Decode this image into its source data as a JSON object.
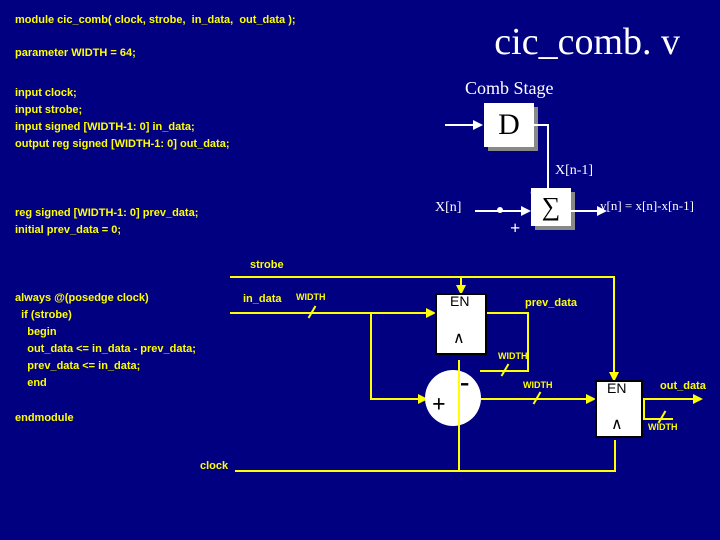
{
  "title": "cic_comb. v",
  "comb_stage": "Comb Stage",
  "code": {
    "l1": "module cic_comb( clock, strobe,  in_data,  out_data );",
    "l2": "parameter WIDTH = 64;",
    "l3": "input clock;",
    "l4": "input strobe;",
    "l5": "input signed [WIDTH-1: 0] in_data;",
    "l6": "output reg signed [WIDTH-1: 0] out_data;",
    "l7": "reg signed [WIDTH-1: 0] prev_data;",
    "l8": "initial prev_data = 0;",
    "l9": "always @(posedge clock)",
    "l10": "  if (strobe)",
    "l11": "    begin",
    "l12": "    out_data <= in_data - prev_data;",
    "l13": "    prev_data <= in_data;",
    "l14": "    end",
    "l15": "endmodule"
  },
  "upper": {
    "D": "D",
    "xn": "X[n]",
    "xn1": "X[n-1]",
    "sigma": "∑",
    "minus": "-",
    "plus": "+",
    "eq": "y[n] = x[n]-x[n-1]"
  },
  "lower": {
    "strobe": "strobe",
    "in_data": "in_data",
    "width1": "WIDTH",
    "width2": "WIDTH",
    "width3": "WIDTH",
    "width4": "WIDTH",
    "clock": "clock",
    "prev_data": "prev_data",
    "out_data": "out_data",
    "EN1": "EN",
    "EN2": "EN",
    "reg": "∧",
    "reg2": "∧",
    "plus": "+",
    "minus": "-"
  }
}
